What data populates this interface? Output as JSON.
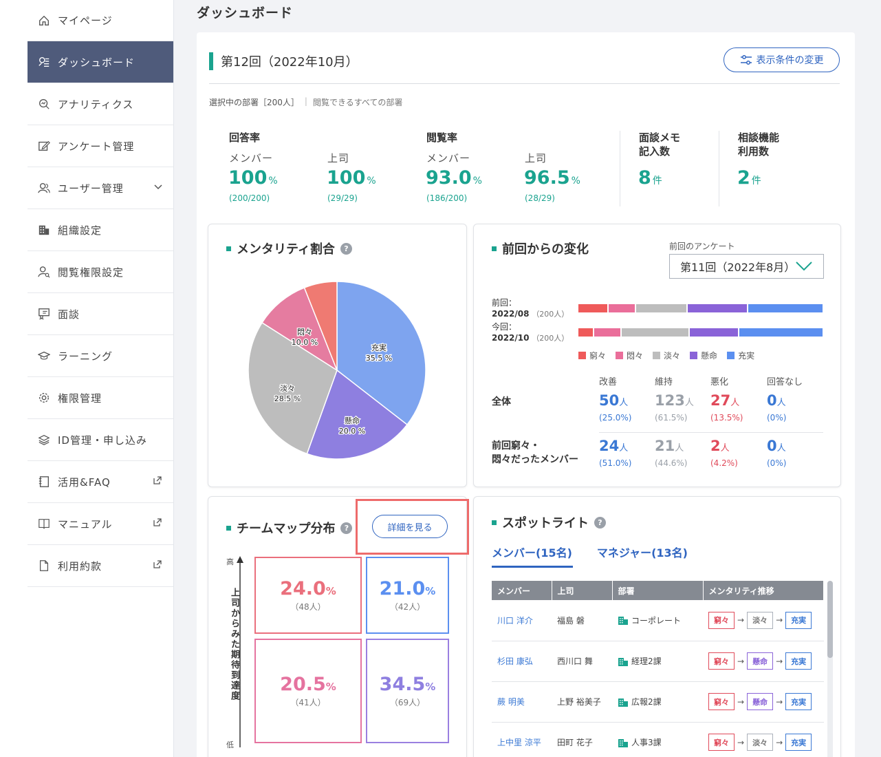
{
  "sidebar": {
    "items": [
      {
        "label": "マイページ"
      },
      {
        "label": "ダッシュボード"
      },
      {
        "label": "アナリティクス"
      },
      {
        "label": "アンケート管理"
      },
      {
        "label": "ユーザー管理"
      },
      {
        "label": "組織設定"
      },
      {
        "label": "閲覧権限設定"
      },
      {
        "label": "面談"
      },
      {
        "label": "ラーニング"
      },
      {
        "label": "権限管理"
      },
      {
        "label": "ID管理・申し込み"
      },
      {
        "label": "活用&FAQ"
      },
      {
        "label": "マニュアル"
      },
      {
        "label": "利用約款"
      }
    ]
  },
  "page": {
    "title": "ダッシュボード",
    "survey_title": "第12回（2022年10月）",
    "filter_button": "表示条件の変更",
    "dept_selected": "選択中の部署［200人］",
    "dept_all": "閲覧できるすべての部署"
  },
  "stats": {
    "answer_label": "回答率",
    "view_label": "閲覧率",
    "memo_label_1": "面談メモ",
    "memo_label_2": "記入数",
    "consult_label_1": "相談機能",
    "consult_label_2": "利用数",
    "member": "メンバー",
    "boss": "上司",
    "answer_member": "100",
    "answer_member_cnt": "(200/200)",
    "answer_boss": "100",
    "answer_boss_cnt": "(29/29)",
    "view_member": "93.0",
    "view_member_cnt": "(186/200)",
    "view_boss": "96.5",
    "view_boss_cnt": "(28/29)",
    "pct": "%",
    "memo_val": "8",
    "consult_val": "2",
    "unit_ken": "件"
  },
  "mentality": {
    "title": "メンタリティ割合",
    "help": "?",
    "labels": {
      "jutsu": "充実",
      "jutsu_pct": "35.5 %",
      "ken": "懸命",
      "ken_pct": "20.0 %",
      "tan": "淡々",
      "tan_pct": "28.5 %",
      "mon": "悶々",
      "mon_pct": "10.0 %"
    }
  },
  "chart_data": {
    "type": "pie",
    "categories": [
      "充実",
      "懸命",
      "淡々",
      "悶々",
      "窮々"
    ],
    "values": [
      35.5,
      20.0,
      28.5,
      10.0,
      6.0
    ],
    "colors": [
      "#7ea4ef",
      "#8e7fe0",
      "#bdbdbd",
      "#e57ca0",
      "#ef7a72"
    ]
  },
  "change": {
    "title": "前回からの変化",
    "prev_label": "前回のアンケート",
    "prev_value": "第11回（2022年8月）",
    "prev_row_1": "前回：",
    "prev_row_2": "2022/08",
    "prev_row_s": "（200人）",
    "cur_row_1": "今回：",
    "cur_row_2": "2022/10",
    "cur_row_s": "（200人）",
    "prev_bar": [
      12,
      11,
      21,
      25,
      31
    ],
    "cur_bar": [
      6,
      11,
      28,
      20,
      35
    ],
    "legend": [
      "窮々",
      "悶々",
      "淡々",
      "懸命",
      "充実"
    ],
    "legend_colors": [
      "#ef5a5a",
      "#ea6e9a",
      "#bdbdbd",
      "#8a63d8",
      "#5b8ff0"
    ],
    "headers": [
      "改善",
      "維持",
      "悪化",
      "回答なし"
    ],
    "row1_label": "全体",
    "row1": [
      {
        "v": "50",
        "p": "(25.0%)"
      },
      {
        "v": "123",
        "p": "(61.5%)"
      },
      {
        "v": "27",
        "p": "(13.5%)"
      },
      {
        "v": "0",
        "p": "(0%)"
      }
    ],
    "row2_label_1": "前回窮々・",
    "row2_label_2": "悶々だったメンバー",
    "row2": [
      {
        "v": "24",
        "p": "(51.0%)"
      },
      {
        "v": "21",
        "p": "(44.6%)"
      },
      {
        "v": "2",
        "p": "(4.2%)"
      },
      {
        "v": "0",
        "p": "(0%)"
      }
    ],
    "unit": "人"
  },
  "teammap": {
    "title": "チームマップ分布",
    "help": "?",
    "detail_button": "詳細を見る",
    "axis_label": "上司からみた期待到達度",
    "tick_high": "高",
    "tick_low": "低",
    "cells": [
      {
        "v": "24.0",
        "n": "（48人）"
      },
      {
        "v": "21.0",
        "n": "（42人）"
      },
      {
        "v": "20.5",
        "n": "（41人）"
      },
      {
        "v": "34.5",
        "n": "（69人）"
      }
    ],
    "pct": "%"
  },
  "spotlight": {
    "title": "スポットライト",
    "help": "?",
    "tab_member": "メンバー(15名)",
    "tab_manager": "マネジャー(13名)",
    "headers": [
      "メンバー",
      "上司",
      "部署",
      "メンタリティ推移"
    ],
    "rows": [
      {
        "name": "川口 洋介",
        "boss": "福島 磐",
        "dept": "コーポレート",
        "t": [
          "窮々",
          "淡々",
          "充実"
        ]
      },
      {
        "name": "杉田 康弘",
        "boss": "西川口 舞",
        "dept": "経理2課",
        "t": [
          "窮々",
          "懸命",
          "充実"
        ]
      },
      {
        "name": "蕨 明美",
        "boss": "上野 裕美子",
        "dept": "広報2課",
        "t": [
          "窮々",
          "懸命",
          "充実"
        ]
      },
      {
        "name": "上中里 涼平",
        "boss": "田町 花子",
        "dept": "人事3課",
        "t": [
          "窮々",
          "淡々",
          "充実"
        ]
      }
    ],
    "arrow": "→"
  }
}
